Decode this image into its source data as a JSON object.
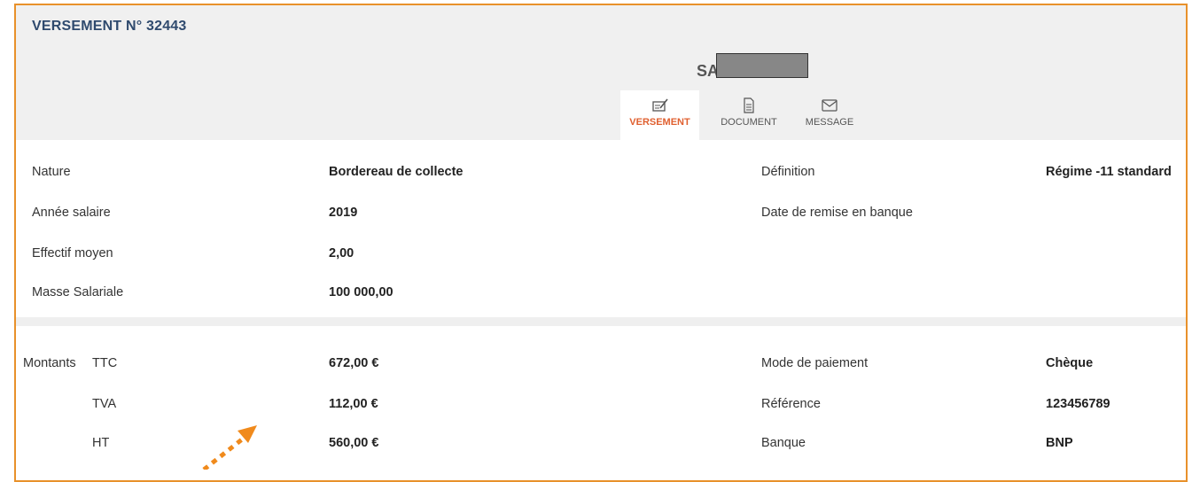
{
  "header": {
    "title": "VERSEMENT N° 32443",
    "company": "SA"
  },
  "tabs": [
    {
      "label": "VERSEMENT",
      "icon": "payment-icon",
      "active": true
    },
    {
      "label": "DOCUMENT",
      "icon": "document-icon",
      "active": false
    },
    {
      "label": "MESSAGE",
      "icon": "envelope-icon",
      "active": false
    }
  ],
  "info": {
    "nature_label": "Nature",
    "nature_value": "Bordereau de collecte",
    "definition_label": "Définition",
    "definition_value": "Régime -11 standard",
    "annee_label": "Année salaire",
    "annee_value": "2019",
    "date_remise_label": "Date de remise en banque",
    "effectif_label": "Effectif moyen",
    "effectif_value": "2,00",
    "masse_label": "Masse Salariale",
    "masse_value": "100 000,00"
  },
  "amounts": {
    "group_label": "Montants",
    "ttc_label": "TTC",
    "ttc_value": "672,00 €",
    "tva_label": "TVA",
    "tva_value": "112,00 €",
    "ht_label": "HT",
    "ht_value": "560,00 €",
    "mode_label": "Mode de paiement",
    "mode_value": "Chèque",
    "ref_label": "Référence",
    "ref_value": "123456789",
    "banque_label": "Banque",
    "banque_value": "BNP"
  },
  "colors": {
    "border": "#e8912b",
    "title": "#2f4a6e",
    "active_tab": "#e06030",
    "arrow": "#f08a1c"
  }
}
